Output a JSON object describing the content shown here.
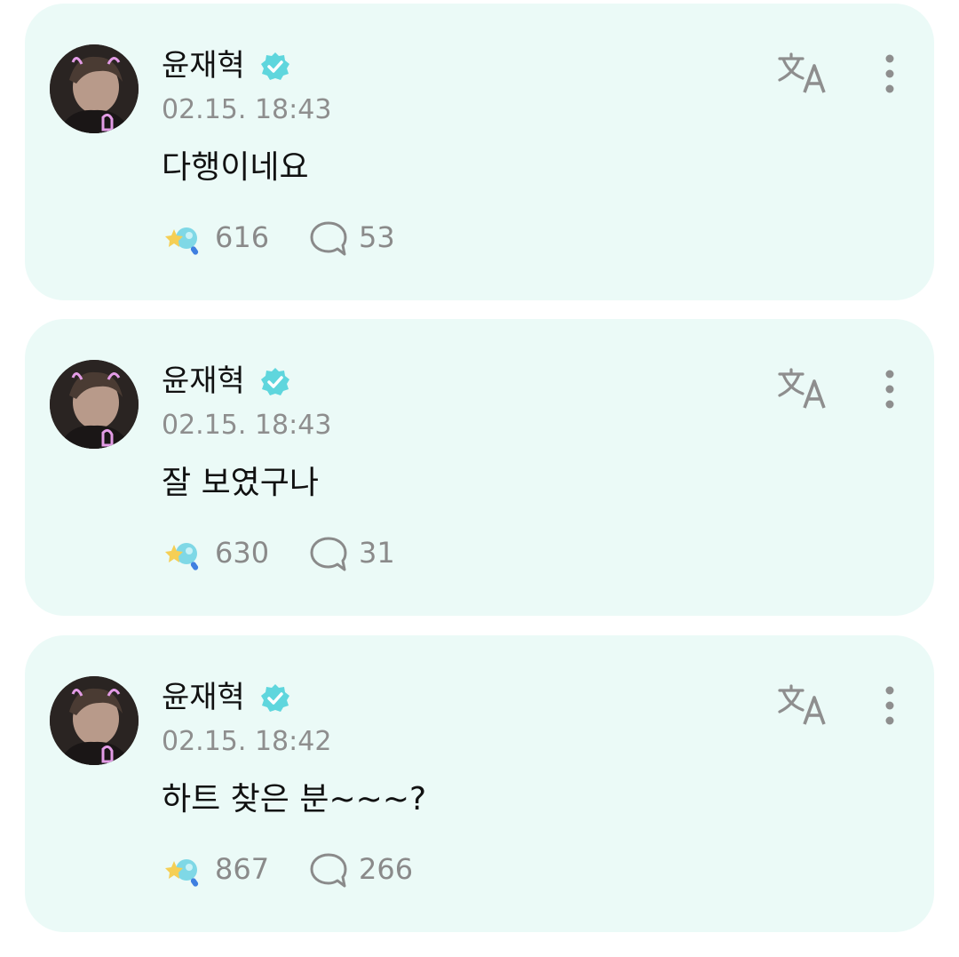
{
  "posts": [
    {
      "author": "윤재혁",
      "time": "02.15. 18:43",
      "text": "다행이네요",
      "likes": "616",
      "comments": "53"
    },
    {
      "author": "윤재혁",
      "time": "02.15. 18:43",
      "text": "잘 보였구나",
      "likes": "630",
      "comments": "31"
    },
    {
      "author": "윤재혁",
      "time": "02.15. 18:42",
      "text": "하트 찾은 분~~~?",
      "likes": "867",
      "comments": "266"
    }
  ],
  "icons": {
    "verified": "verified-badge-icon",
    "translate": "translate-icon",
    "more": "more-vertical-icon",
    "like": "star-lightstick-icon",
    "comment": "comment-bubble-icon"
  },
  "colors": {
    "card_background": "#ebfaf7",
    "verified": "#5fd6dd",
    "muted_text": "#8e8e8e",
    "primary_text": "#111111"
  }
}
